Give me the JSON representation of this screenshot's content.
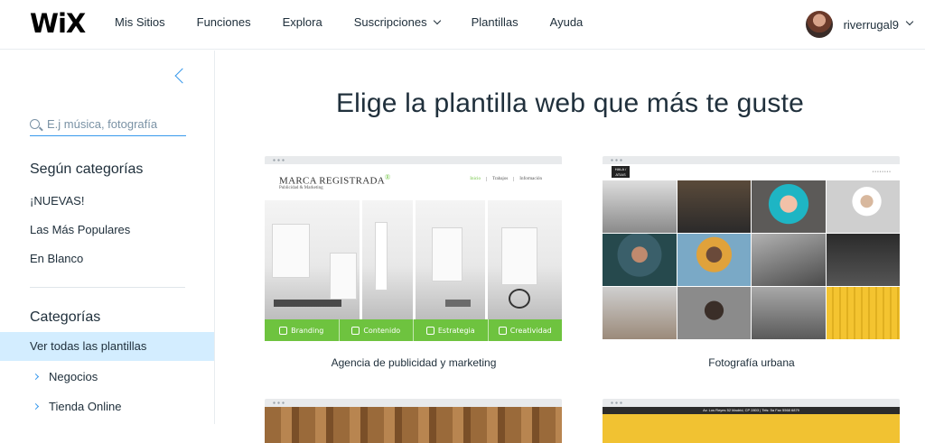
{
  "brand": {
    "logo": "WiX"
  },
  "nav": {
    "items": [
      "Mis Sitios",
      "Funciones",
      "Explora",
      "Suscripciones",
      "Plantillas",
      "Ayuda"
    ]
  },
  "user": {
    "name": "riverrugal9"
  },
  "sidebar": {
    "search_placeholder": "E.j música, fotografía",
    "section1_title": "Según categorías",
    "section1_items": [
      "¡NUEVAS!",
      "Las Más Populares",
      "En Blanco"
    ],
    "section2_title": "Categorías",
    "active_item": "Ver todas las plantillas",
    "sub_items": [
      "Negocios",
      "Tienda Online"
    ]
  },
  "main": {
    "headline": "Elige la plantilla web que más te guste",
    "cards": [
      {
        "label": "Agencia de publicidad y marketing",
        "brand_title": "MARCA REGISTRADA",
        "brand_mark": "®",
        "brand_sub": "Publicidad & Marketing",
        "nav": [
          "Inicio",
          "Trabajos",
          "Información"
        ],
        "features": [
          "Branding",
          "Contenido",
          "Estrategia",
          "Creatividad"
        ]
      },
      {
        "label": "Fotografía urbana",
        "logo_text": "HALA / ATIAS"
      },
      {
        "label": "",
        "address": "Av. Los Reyes 52 Madrid, CP 2803 | Tels: 5a Fax 5568 6879"
      }
    ]
  },
  "colors": {
    "accent": "#3899ec",
    "active_bg": "#d3edff",
    "template_green": "#6ec33f"
  }
}
